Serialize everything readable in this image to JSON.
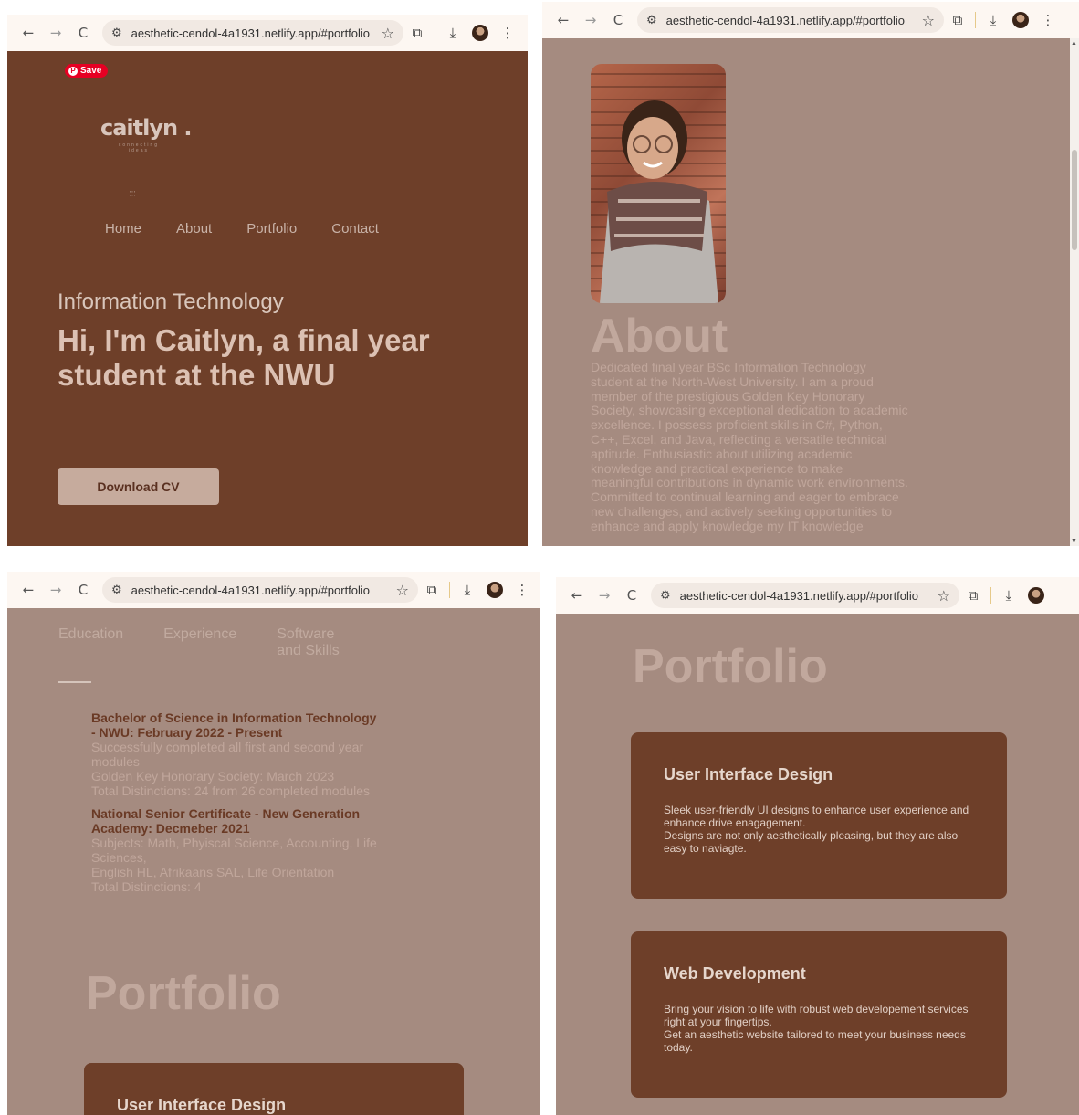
{
  "browser": {
    "url": "aesthetic-cendol-4a1931.netlify.app/#portfolio",
    "icons": {
      "back": "←",
      "forward": "→",
      "reload": "C",
      "tune": "⚙",
      "star": "☆",
      "extensions": "⧉",
      "download": "⤓",
      "menu": "⋮"
    }
  },
  "hero": {
    "pin_label": "Save",
    "logo": "caitlyn .",
    "logo_tagline": "connecting ideas",
    "nav": [
      "Home",
      "About",
      "Portfolio",
      "Contact"
    ],
    "subtitle": "Information Technology",
    "title": "Hi, I'm Caitlyn, a final year student at the NWU",
    "cv_button": "Download CV"
  },
  "about": {
    "heading": "About",
    "text": "Dedicated final year BSc Information Technology student at the North-West University. I am a proud member of the prestigious Golden Key Honorary Society, showcasing exceptional dedication to academic excellence. I possess proficient skills in C#, Python, C++, Excel, and Java, reflecting a versatile technical aptitude. Enthusiastic about utilizing academic knowledge and practical experience to make meaningful contributions in dynamic work environments. Committed to continual learning and eager to embrace new challenges, and actively seeking opportunities to enhance and apply knowledge my IT knowledge"
  },
  "education": {
    "tabs": [
      "Education",
      "Experience",
      "Software and Skills"
    ],
    "entries": [
      {
        "title": "Bachelor of Science in Information Technology - NWU: February 2022 - Present",
        "lines": [
          "Successfully completed all first and second year modules",
          "Golden Key Honorary Society: March 2023",
          "Total Distinctions: 24 from 26 completed modules"
        ]
      },
      {
        "title": "National Senior Certificate - New Generation Academy: Decmeber 2021",
        "lines": [
          "Subjects: Math, Phyiscal Science, Accounting, Life Sciences,",
          "English HL, Afrikaans SAL, Life Orientation",
          "Total Distinctions: 4"
        ]
      }
    ]
  },
  "portfolio": {
    "heading": "Portfolio",
    "cards": [
      {
        "title": "User Interface Design",
        "lines": [
          "Sleek user-friendly UI designs to enhance user experience and enhance drive enagagement.",
          "Designs are not only aesthetically pleasing, but they are also easy to naviagte."
        ]
      },
      {
        "title": "Web Development",
        "lines": [
          "Bring your vision to life with robust web developement services right at your fingertips.",
          "Get an aesthetic website tailored to meet your business needs today."
        ]
      }
    ]
  }
}
